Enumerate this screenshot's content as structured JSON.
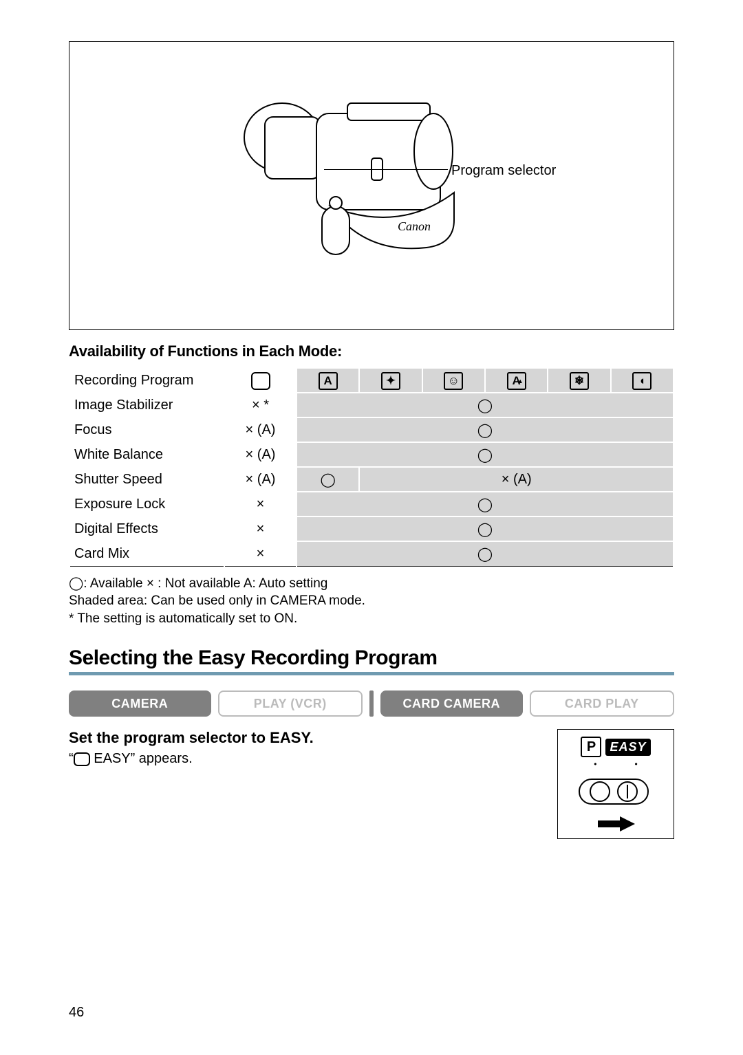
{
  "diagram": {
    "label": "Program selector"
  },
  "availability": {
    "heading": "Availability of Functions in Each Mode:",
    "header_row": "Recording Program",
    "mode_icons": [
      "easy",
      "A",
      "sports",
      "portrait",
      "spotlight",
      "sand-snow",
      "low-light"
    ],
    "rows": [
      {
        "label": "Image Stabilizer",
        "easy": "× *",
        "rest": "◯",
        "split": false
      },
      {
        "label": "Focus",
        "easy": "× (A)",
        "rest": "◯",
        "split": false
      },
      {
        "label": "White Balance",
        "easy": "× (A)",
        "rest": "◯",
        "split": false
      },
      {
        "label": "Shutter Speed",
        "easy": "× (A)",
        "rest_a": "◯",
        "rest_b": "× (A)",
        "split": true
      },
      {
        "label": "Exposure Lock",
        "easy": "×",
        "rest": "◯",
        "split": false
      },
      {
        "label": "Digital Effects",
        "easy": "×",
        "rest": "◯",
        "split": false
      },
      {
        "label": "Card Mix",
        "easy": "×",
        "rest": "◯",
        "split": false
      }
    ],
    "legend1": "◯: Available    × : Not available   A: Auto setting",
    "legend2": "Shaded area: Can be used only in CAMERA mode.",
    "legend3": "* The setting is automatically set to ON."
  },
  "section": {
    "title": "Selecting the Easy Recording Program",
    "modes": [
      {
        "label": "CAMERA",
        "active": true
      },
      {
        "label": "PLAY (VCR)",
        "active": false
      },
      {
        "label": "CARD CAMERA",
        "active": true
      },
      {
        "label": "CARD PLAY",
        "active": false
      }
    ],
    "instruction": "Set the program selector to EASY.",
    "sub_prefix": "“",
    "sub_easy": " EASY” appears.",
    "selector_badge": {
      "p": "P",
      "easy": "EASY"
    }
  },
  "page_number": "46"
}
